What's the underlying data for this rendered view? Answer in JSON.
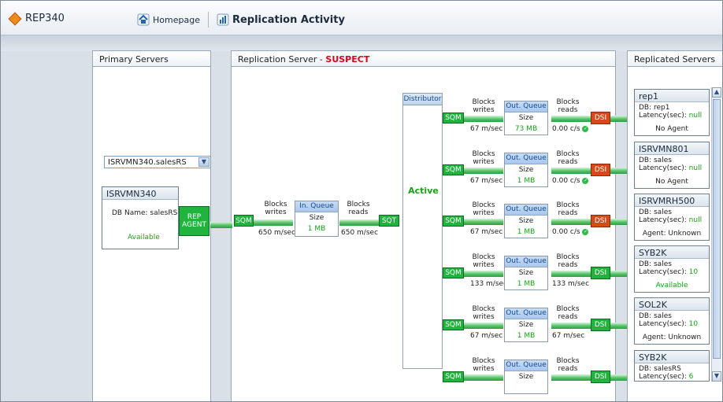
{
  "header": {
    "app_name": "REP340",
    "home_label": "Homepage",
    "page_title": "Replication Activity"
  },
  "panels": {
    "primary_title": "Primary Servers",
    "replication_prefix": "Replication Server - ",
    "replication_status": "SUSPECT",
    "replicated_title": "Replicated Servers"
  },
  "primary": {
    "selected_server": "ISRVMN340.salesRS",
    "card_title": "ISRVMN340",
    "db_name": "DB Name: salesRS",
    "status": "Available",
    "rep_agent_line1": "REP",
    "rep_agent_line2": "AGENT"
  },
  "inbound": {
    "sqm": "SQM",
    "blocks_writes_1": "Blocks",
    "blocks_writes_2": "writes",
    "rate_in": "650 m/sec",
    "queue_title": "In. Queue",
    "size": "Size",
    "queue_value": "1 MB",
    "blocks_reads_1": "Blocks",
    "blocks_reads_2": "reads",
    "rate_out": "650 m/sec",
    "sqt": "SQT"
  },
  "distributor": {
    "title": "Distributor",
    "status": "Active"
  },
  "outbound": [
    {
      "queue_value": "73 MB",
      "write_rate": "67 m/sec",
      "read_rate": "0.00 c/s",
      "dsi_state": "red"
    },
    {
      "queue_value": "1 MB",
      "write_rate": "67 m/sec",
      "read_rate": "0.00 c/s",
      "dsi_state": "red"
    },
    {
      "queue_value": "1 MB",
      "write_rate": "67 m/sec",
      "read_rate": "0.00 c/s",
      "dsi_state": "red"
    },
    {
      "queue_value": "1 MB",
      "write_rate": "133 m/sec",
      "read_rate": "133 m/sec",
      "dsi_state": "green"
    },
    {
      "queue_value": "1 MB",
      "write_rate": "67 m/sec",
      "read_rate": "67 m/sec",
      "dsi_state": "green"
    },
    {
      "queue_value": "",
      "write_rate": "",
      "read_rate": "",
      "dsi_state": "green"
    }
  ],
  "outbound_labels": {
    "sqm": "SQM",
    "blocks_1": "Blocks",
    "writes": "writes",
    "reads": "reads",
    "queue_title": "Out. Queue",
    "size": "Size",
    "dsi": "DSI"
  },
  "replicated": [
    {
      "name": "rep1",
      "db": "DB: rep1",
      "latency_label": "Latency(sec): ",
      "latency_value": "null",
      "status": "No Agent"
    },
    {
      "name": "ISRVMN801",
      "db": "DB: sales",
      "latency_label": "Latency(sec): ",
      "latency_value": "null",
      "status": "No Agent"
    },
    {
      "name": "ISRVMRH500",
      "db": "DB: sales",
      "latency_label": "Latency(sec): ",
      "latency_value": "null",
      "status": "Agent: Unknown"
    },
    {
      "name": "SYB2K",
      "db": "DB: sales",
      "latency_label": "Latency(sec): ",
      "latency_value": "10",
      "status": "Available"
    },
    {
      "name": "SOL2K",
      "db": "DB: sales",
      "latency_label": "Latency(sec): ",
      "latency_value": "10",
      "status": "Agent: Unknown"
    },
    {
      "name": "SYB2K",
      "db": "DB: salesRS",
      "latency_label": "Latency(sec): ",
      "latency_value": "6",
      "status": ""
    }
  ],
  "colors": {
    "green": "#20b43e",
    "red": "#d54a1a",
    "accent_blue": "#134b93",
    "suspect": "#e0001a"
  }
}
